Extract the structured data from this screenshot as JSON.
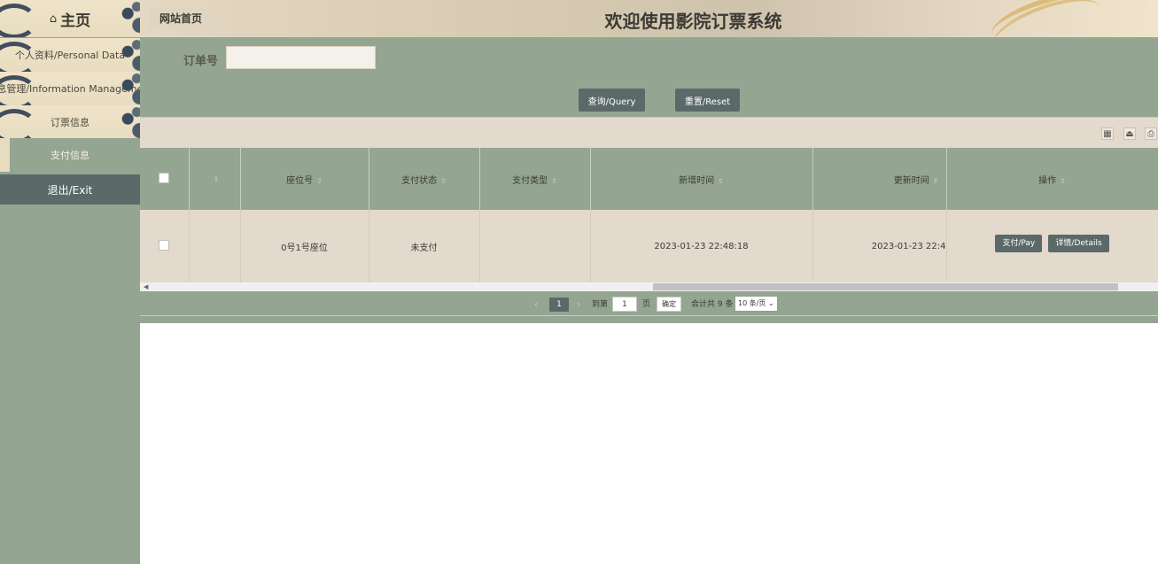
{
  "sidebar": {
    "home": "主页",
    "items": [
      {
        "label": "个人资料/Personal Data"
      },
      {
        "label": "信息管理/Information Management"
      },
      {
        "label": "订票信息"
      },
      {
        "label": "支付信息"
      },
      {
        "label": "退出/Exit"
      }
    ]
  },
  "header": {
    "site_home": "网站首页",
    "title": "欢迎使用影院订票系统"
  },
  "search": {
    "label": "订单号",
    "value": "",
    "query_button": "查询/Query",
    "reset_button": "重置/Reset"
  },
  "toolbar": {
    "icons": [
      "columns-icon",
      "export-icon",
      "print-icon"
    ]
  },
  "table": {
    "columns": [
      "",
      "",
      "座位号",
      "支付状态",
      "支付类型",
      "新增时间",
      "更新时间",
      "操作"
    ],
    "rows": [
      {
        "seat": "0号1号座位",
        "pay_status": "未支付",
        "pay_type": "",
        "created": "2023-01-23 22:48:18",
        "updated": "2023-01-23 22:4",
        "actions": [
          "支付/Pay",
          "详情/Details"
        ]
      }
    ]
  },
  "pager": {
    "prev": "‹",
    "current_page": "1",
    "next": "›",
    "goto_label": "到第",
    "goto_value": "1",
    "page_unit": "页",
    "confirm": "确定",
    "total": "合计共 9 条",
    "page_size": "10 条/页"
  },
  "colors": {
    "sage": "#94a591",
    "dark_slate": "#5b6a69",
    "beige": "#e3d9cc"
  }
}
